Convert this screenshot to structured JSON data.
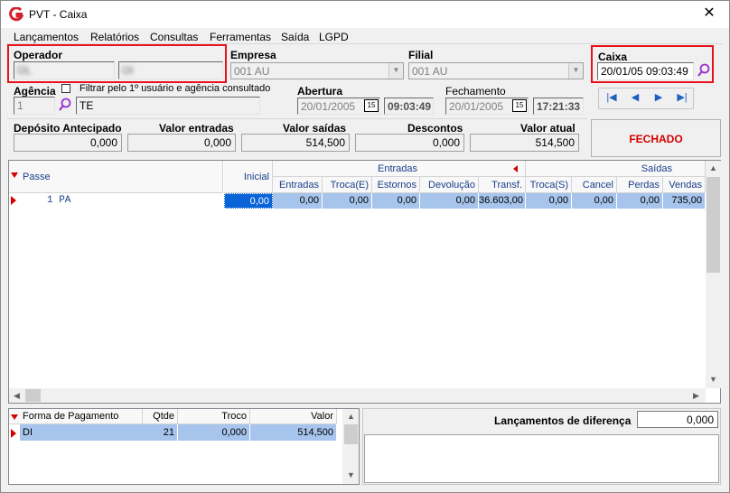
{
  "window": {
    "title": "PVT - Caixa",
    "close": "✕"
  },
  "menu": [
    "Lançamentos",
    "Relatórios",
    "Consultas",
    "Ferramentas",
    "Saída",
    "LGPD"
  ],
  "operador": {
    "label": "Operador",
    "code": "OL",
    "name": "Ol"
  },
  "empresa": {
    "label": "Empresa",
    "value": "001 AU"
  },
  "filial": {
    "label": "Filial",
    "value": "001 AU"
  },
  "caixa": {
    "label": "Caixa",
    "value": "20/01/05 09:03:49"
  },
  "agencia": {
    "label": "Agência",
    "value": "1",
    "name": "TE",
    "filter_label": "Filtrar pelo 1º usuário e agência consultado"
  },
  "abertura": {
    "label": "Abertura",
    "date": "20/01/2005",
    "time": "09:03:49"
  },
  "fechamento": {
    "label": "Fechamento",
    "date": "20/01/2005",
    "time": "17:21:33"
  },
  "calendar_label": "15",
  "summary": {
    "deposito": {
      "label": "Depósito Antecipado",
      "value": "0,000"
    },
    "entradas": {
      "label": "Valor entradas",
      "value": "0,000"
    },
    "saidas": {
      "label": "Valor saídas",
      "value": "514,500"
    },
    "descontos": {
      "label": "Descontos",
      "value": "0,000"
    },
    "atual": {
      "label": "Valor atual",
      "value": "514,500"
    }
  },
  "status": "FECHADO",
  "grid": {
    "passe_header": "Passe",
    "inicial_header": "Inicial",
    "group_entradas": "Entradas",
    "group_saidas": "Saídas",
    "columns": [
      "Entradas",
      "Troca(E)",
      "Estornos",
      "Devolução",
      "Transf.",
      "Troca(S)",
      "Cancel",
      "Perdas",
      "Vendas"
    ],
    "row": {
      "passe": "1 PA",
      "inicial": "0,00",
      "values": [
        "0,00",
        "0,00",
        "0,00",
        "0,00",
        "36.603,00",
        "0,00",
        "0,00",
        "0,00",
        "735,00"
      ]
    }
  },
  "payments": {
    "headers": [
      "Forma de Pagamento",
      "Qtde",
      "Troco",
      "Valor"
    ],
    "row": {
      "forma": "DI",
      "qtde": "21",
      "troco": "0,000",
      "valor": "514,500"
    }
  },
  "diferenca": {
    "label": "Lançamentos de diferença",
    "value": "0,000"
  },
  "colors": {
    "highlight_red": "#e8121b",
    "row_blue": "#a6c4ec",
    "status_red": "#d40000"
  }
}
